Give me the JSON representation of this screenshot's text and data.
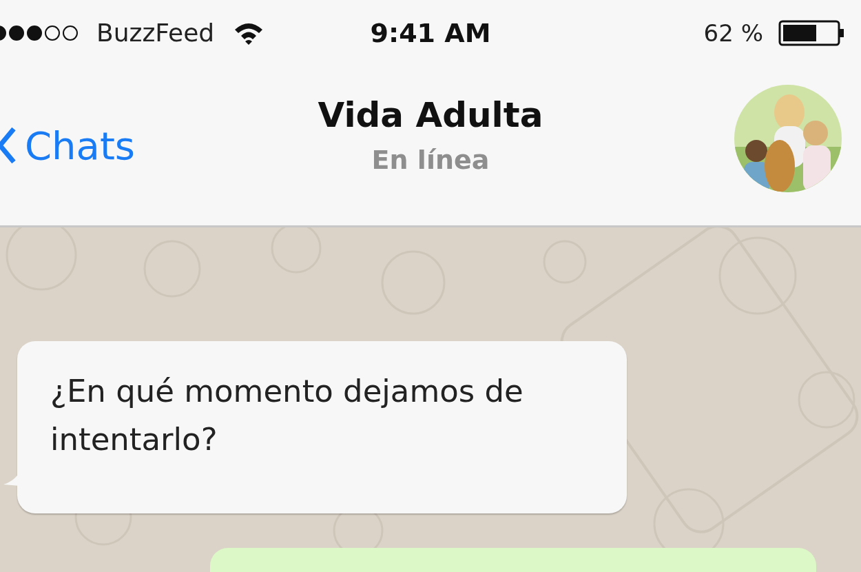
{
  "status_bar": {
    "carrier": "BuzzFeed",
    "time": "9:41 AM",
    "battery": "62 %"
  },
  "nav_bar": {
    "back": "Chats",
    "title": "Vida Adulta",
    "subtitle": "En línea"
  },
  "messages": [
    {
      "kind": "incoming",
      "text": "¿En qué momento dejamos de intentarlo?"
    },
    {
      "kind": "outgoing"
    }
  ]
}
